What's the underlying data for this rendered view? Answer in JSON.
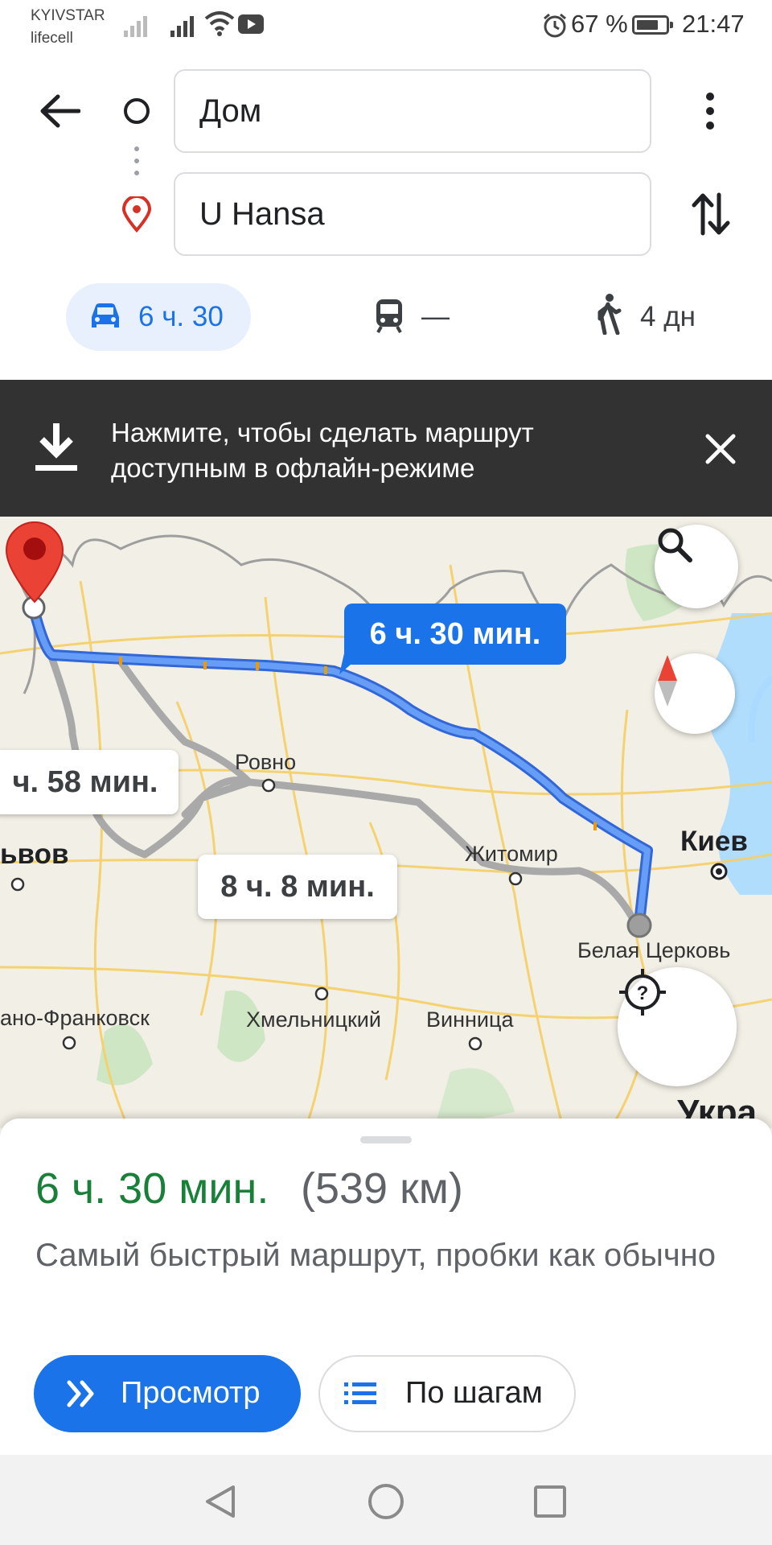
{
  "status_bar": {
    "carrier_1": "KYIVSTAR",
    "carrier_2": "lifecell",
    "battery_percent": "67 %",
    "time": "21:47"
  },
  "route_inputs": {
    "origin": "Дом",
    "destination": "U Hansa"
  },
  "travel_modes": {
    "car": "6 ч. 30",
    "transit": "—",
    "walk": "4 дн"
  },
  "offline_banner": {
    "text": "Нажмите, чтобы сделать маршрут доступным в офлайн-режиме"
  },
  "map": {
    "route_labels": {
      "primary": "6 ч. 30 мин.",
      "alt_1": "ч. 58 мин.",
      "alt_2": "8 ч. 8 мин."
    },
    "cities": {
      "rovno": "Ровно",
      "lvov": "ьвов",
      "zhitomir": "Житомир",
      "kiev": "Киев",
      "belaya_tserkov": "Белая Церковь",
      "ivano_frankovsk": "ано-Франковск",
      "khmelnitsky": "Хмельницкий",
      "vinnitsa": "Винница",
      "ukraine": "Укра"
    }
  },
  "summary": {
    "duration": "6 ч. 30 мин.",
    "distance": "(539 км)",
    "description": "Самый быстрый маршрут, пробки как обычно",
    "preview_button": "Просмотр",
    "steps_button": "По шагам"
  },
  "colors": {
    "accent_blue": "#1a73e8",
    "duration_green": "#188038",
    "banner_bg": "#323232",
    "route_alt_gray": "#a8a8a8"
  }
}
